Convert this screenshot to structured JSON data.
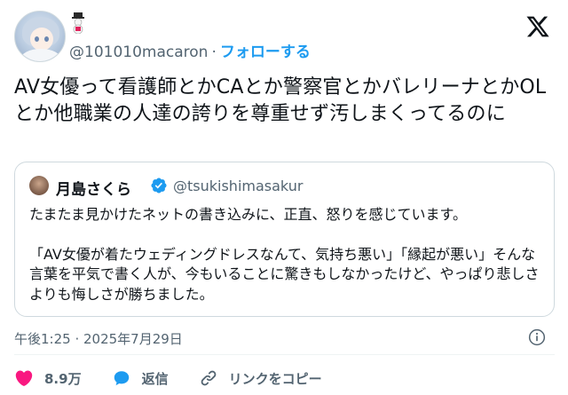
{
  "author": {
    "handle": "@101010macaron",
    "separator": "·",
    "follow_label": "フォローする"
  },
  "tweet": {
    "text": "AV女優って看護師とかCAとか警察官とかバレリーナとかOLとか他職業の人達の誇りを尊重せず汚しまくってるのに"
  },
  "quote": {
    "name": "月島さくら",
    "handle": "@tsukishimasakur",
    "paragraphs": [
      "たまたま見かけたネットの書き込みに、正直、怒りを感じています。",
      "「AV女優が着たウェディングドレスなんて、気持ち悪い」「縁起が悪い」そんな言葉を平気で書く人が、今もいることに驚きもしなかったけど、やっぱり悲しさよりも悔しさが勝ちました。"
    ]
  },
  "meta": {
    "timestamp": "午後1:25 · 2025年7月29日"
  },
  "actions": {
    "like_count": "8.9万",
    "reply_label": "返信",
    "copy_link_label": "リンクをコピー"
  },
  "colors": {
    "accent": "#1d9bf0",
    "like": "#f91880",
    "muted": "#536471",
    "border": "#cfd9de"
  }
}
